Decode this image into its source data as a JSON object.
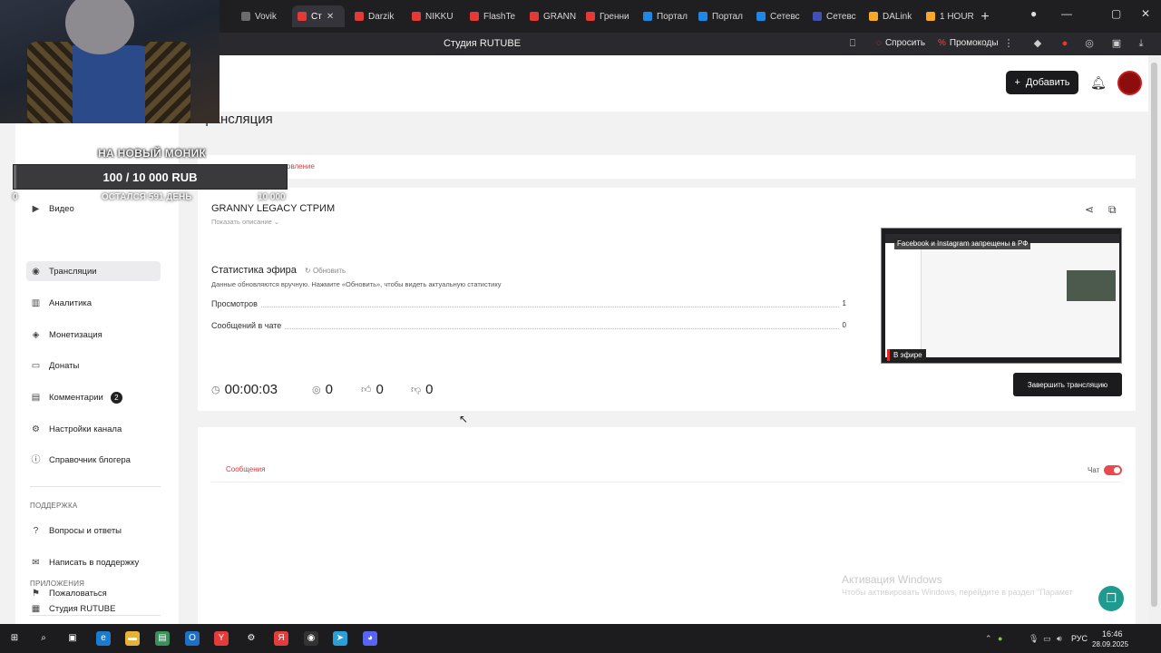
{
  "browser": {
    "tabs": [
      {
        "label": "Vovik",
        "color": "#6b6b6b"
      },
      {
        "label": "Ст",
        "color": "#e53935"
      },
      {
        "label": "Darzik",
        "color": "#e53935"
      },
      {
        "label": "NIKKU",
        "color": "#e53935"
      },
      {
        "label": "FlashTe",
        "color": "#e53935"
      },
      {
        "label": "GRANN",
        "color": "#e53935"
      },
      {
        "label": "Гренни",
        "color": "#e53935"
      },
      {
        "label": "Портал",
        "color": "#1e88e5"
      },
      {
        "label": "Портал",
        "color": "#1e88e5"
      },
      {
        "label": "Сетевс",
        "color": "#1e88e5"
      },
      {
        "label": "Сетевс",
        "color": "#3f51b5"
      },
      {
        "label": "DALink",
        "color": "#f9a825"
      },
      {
        "label": "1 HOUR",
        "color": "#f9a825"
      }
    ],
    "page_title": "Студия RUTUBE",
    "ask_label": "Спросить",
    "promo_label": "Промокоды"
  },
  "header": {
    "add_label": "Добавить"
  },
  "page_title": "Трансляция",
  "tabs_row": {
    "active_fragment": "овление"
  },
  "sidebar": {
    "items": [
      {
        "label": "Видео",
        "icon": "play-icon"
      },
      {
        "label": "Трансляции",
        "icon": "broadcast-icon"
      },
      {
        "label": "Аналитика",
        "icon": "chart-icon"
      },
      {
        "label": "Монетизация",
        "icon": "money-icon"
      },
      {
        "label": "Донаты",
        "icon": "wallet-icon"
      },
      {
        "label": "Комментарии",
        "icon": "comment-icon",
        "badge": "2"
      },
      {
        "label": "Настройки канала",
        "icon": "gear-icon"
      },
      {
        "label": "Справочник блогера",
        "icon": "info-icon"
      }
    ],
    "support_heading": "ПОДДЕРЖКА",
    "support_items": [
      {
        "label": "Вопросы и ответы",
        "icon": "question-icon"
      },
      {
        "label": "Написать в поддержку",
        "icon": "mail-icon"
      },
      {
        "label": "Пожаловаться",
        "icon": "flag-icon"
      }
    ],
    "apps_heading": "ПРИЛОЖЕНИЯ",
    "apps_items": [
      {
        "label": "Студия RUTUBE",
        "icon": "studio-icon"
      }
    ]
  },
  "stream": {
    "title": "GRANNY LEGACY СТРИМ",
    "show_description": "Показать описание",
    "stats_title": "Статистика эфира",
    "refresh_label": "Обновить",
    "stats_note": "Данные обновляются вручную. Нажмите «Обновить», чтобы видеть актуальную статистику",
    "rows": [
      {
        "label": "Просмотров",
        "value": "1"
      },
      {
        "label": "Сообщений в чате",
        "value": "0"
      }
    ],
    "duration": "00:00:03",
    "viewers": "0",
    "likes": "0",
    "dislikes": "0",
    "preview_banner": "Facebook и Instagram запрещены в РФ",
    "live_label": "В эфире",
    "finish_label": "Завершить трансляцию"
  },
  "chat": {
    "tab_label": "Сообщения",
    "toggle_label": "Чат",
    "toggle_on": true
  },
  "overlay": {
    "goal_title": "НА НОВЫЙ МОНИК",
    "goal_progress": "100 / 10 000 RUB",
    "goal_fraction": 0.01,
    "goal_days_left": "ОСТАЛСЯ 591 ДЕНЬ",
    "goal_max": "10 000",
    "goal_min": "0"
  },
  "windows": {
    "activation_title": "Активация Windows",
    "activation_text": "Чтобы активировать Windows, перейдите в раздел \"Парамет"
  },
  "taskbar": {
    "lang": "РУС",
    "time": "16:46",
    "date": "28.09.2025"
  }
}
